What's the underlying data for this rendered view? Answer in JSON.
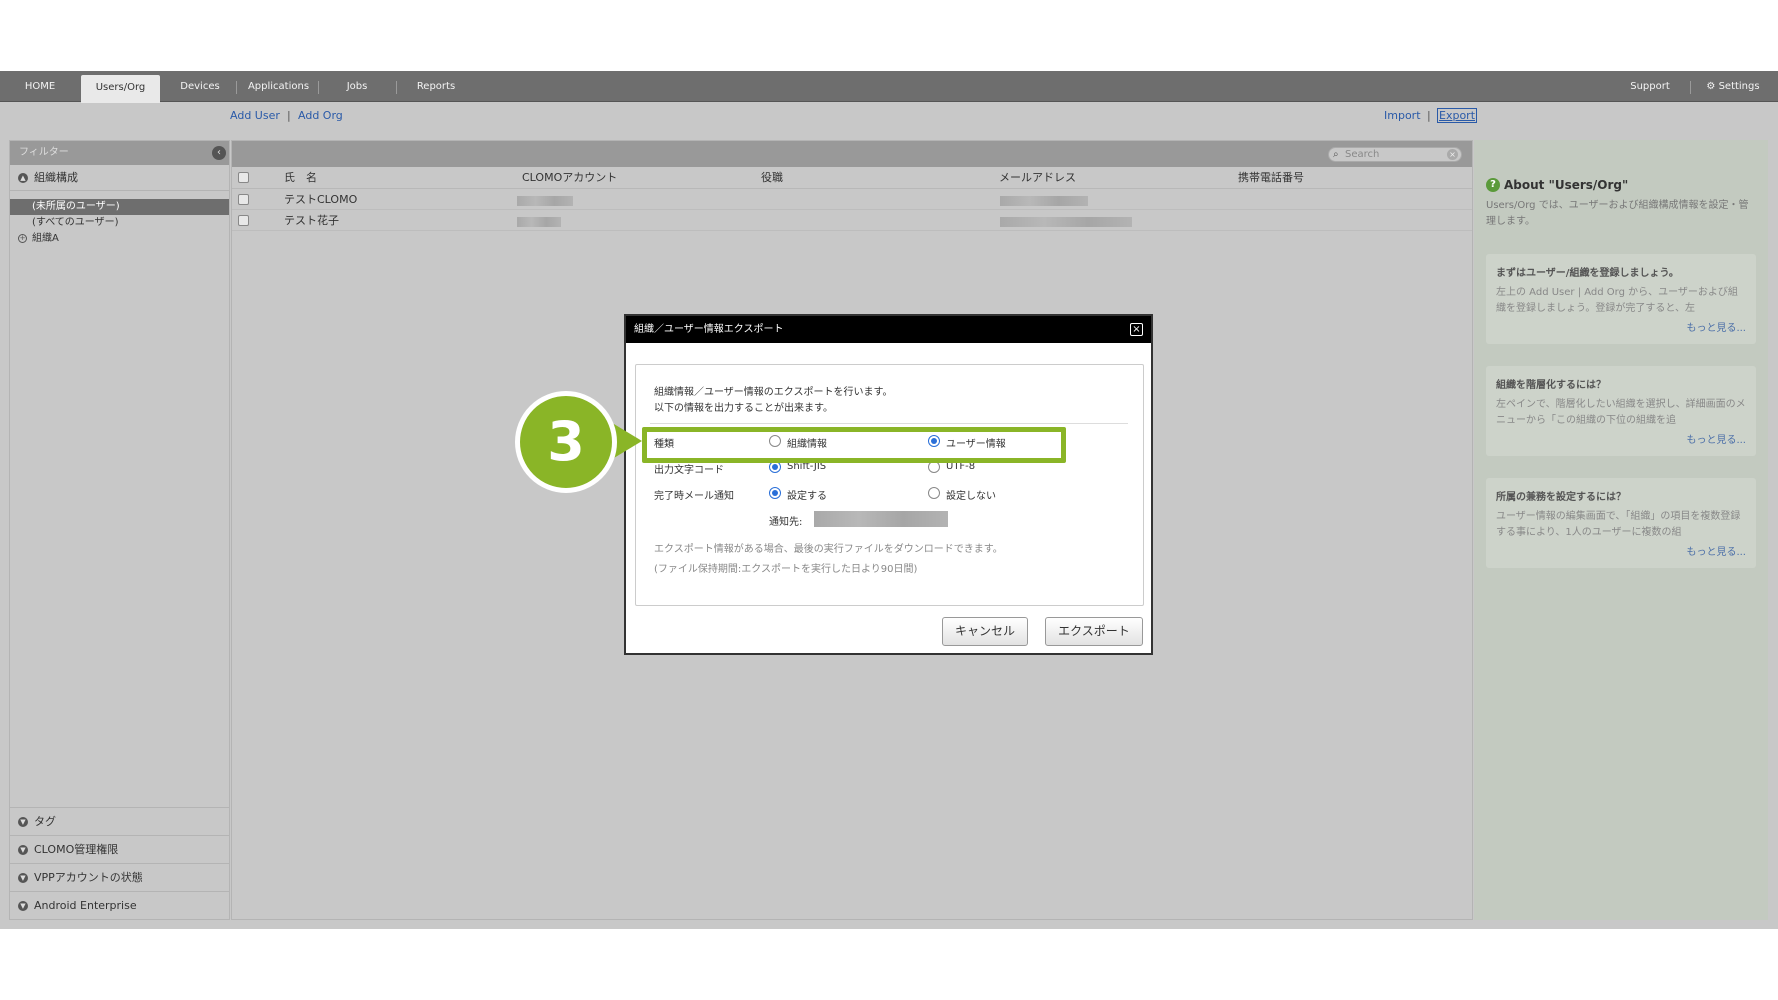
{
  "nav": {
    "tabs": [
      {
        "label": "HOME"
      },
      {
        "label": "Users/Org"
      },
      {
        "label": "Devices"
      },
      {
        "label": "Applications"
      },
      {
        "label": "Jobs"
      },
      {
        "label": "Reports"
      }
    ],
    "support": "Support",
    "settings": "Settings"
  },
  "subbar": {
    "add_user": "Add User",
    "add_org": "Add Org",
    "import": "Import",
    "export": "Export",
    "sep": "|"
  },
  "filter": {
    "title": "フィルター",
    "org_section": "組織構成",
    "tree": [
      "(未所属のユーザー)",
      "(すべてのユーザー)",
      "組織A"
    ],
    "bottom_sections": [
      "タグ",
      "CLOMO管理権限",
      "VPPアカウントの状態",
      "Android Enterprise"
    ]
  },
  "table": {
    "search_placeholder": "Search",
    "columns": [
      "氏　名",
      "CLOMOアカウント",
      "役職",
      "メールアドレス",
      "携帯電話番号"
    ],
    "rows": [
      {
        "name": "テストCLOMO"
      },
      {
        "name": "テスト花子"
      }
    ]
  },
  "help": {
    "title": "About \"Users/Org\"",
    "desc": "Users/Org では、ユーザーおよび組織構成情報を設定・管理します。",
    "cards": [
      {
        "title": "まずはユーザー/組織を登録しましょう。",
        "text": "左上の Add User | Add Org から、ユーザーおよび組織を登録しましょう。登録が完了すると、左",
        "more": "もっと見る..."
      },
      {
        "title": "組織を階層化するには？",
        "text": "左ペインで、階層化したい組織を選択し、詳細画面のメニューから「この組織の下位の組織を追",
        "more": "もっと見る..."
      },
      {
        "title": "所属の兼務を設定するには？",
        "text": "ユーザー情報の編集画面で、「組織」の項目を複数登録する事により、1人のユーザーに複数の組",
        "more": "もっと見る..."
      }
    ]
  },
  "dialog": {
    "title": "組織／ユーザー情報エクスポート",
    "intro1": "組織情報／ユーザー情報のエクスポートを行います。",
    "intro2": "以下の情報を出力することが出来ます。",
    "type_label": "種類",
    "type_opt1": "組織情報",
    "type_opt2": "ユーザー情報",
    "type_selected": "ユーザー情報",
    "enc_label": "出力文字コード",
    "enc_opt1": "Shift-JIS",
    "enc_opt2": "UTF-8",
    "enc_selected": "Shift-JIS",
    "mail_label": "完了時メール通知",
    "mail_opt1": "設定する",
    "mail_opt2": "設定しない",
    "mail_selected": "設定する",
    "notify_label": "通知先:",
    "note1": "エクスポート情報がある場合、最後の実行ファイルをダウンロードできます。",
    "note2": "(ファイル保持期間:エクスポートを実行した日より90日間)",
    "cancel": "キャンセル",
    "export": "エクスポート"
  },
  "step": {
    "number": "3"
  },
  "colors": {
    "highlight": "#8ab527",
    "nav_bg": "#6e6e6e",
    "radio_on": "#2a6fd8"
  }
}
